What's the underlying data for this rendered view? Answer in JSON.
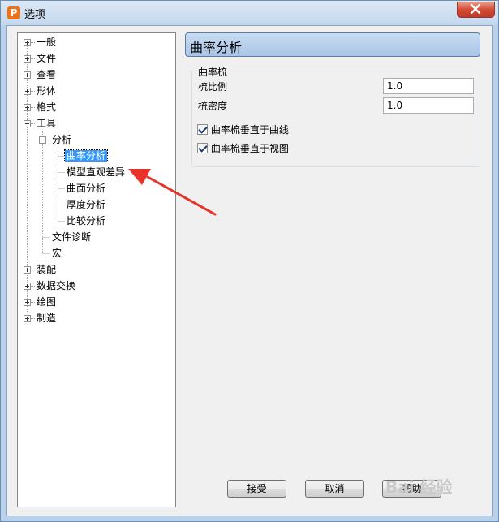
{
  "window": {
    "title": "选项",
    "app_icon_letter": "P"
  },
  "tree": {
    "items": [
      {
        "label": "一般",
        "state": "collapsed"
      },
      {
        "label": "文件",
        "state": "collapsed"
      },
      {
        "label": "查看",
        "state": "collapsed"
      },
      {
        "label": "形体",
        "state": "collapsed"
      },
      {
        "label": "格式",
        "state": "collapsed"
      },
      {
        "label": "工具",
        "state": "expanded"
      },
      {
        "label": "分析",
        "state": "expanded"
      },
      {
        "label": "曲率分析",
        "state": "selected"
      },
      {
        "label": "模型直观差异"
      },
      {
        "label": "曲面分析"
      },
      {
        "label": "厚度分析"
      },
      {
        "label": "比较分析"
      },
      {
        "label": "文件诊断"
      },
      {
        "label": "宏"
      },
      {
        "label": "装配",
        "state": "collapsed"
      },
      {
        "label": "数据交换",
        "state": "collapsed"
      },
      {
        "label": "绘图",
        "state": "collapsed"
      },
      {
        "label": "制造",
        "state": "collapsed"
      }
    ]
  },
  "panel": {
    "title": "曲率分析",
    "group_caption": "曲率梳",
    "fields": [
      {
        "label": "梳比例",
        "value": "1.0"
      },
      {
        "label": "梳密度",
        "value": "1.0"
      }
    ],
    "checkboxes": [
      {
        "label": "曲率梳垂直于曲线",
        "checked": true
      },
      {
        "label": "曲率梳垂直于视图",
        "checked": true
      }
    ]
  },
  "buttons": {
    "accept": "接受",
    "cancel": "取消",
    "help": "帮助"
  },
  "watermark": "Bai 经验",
  "annotation_color": "#e8322a"
}
